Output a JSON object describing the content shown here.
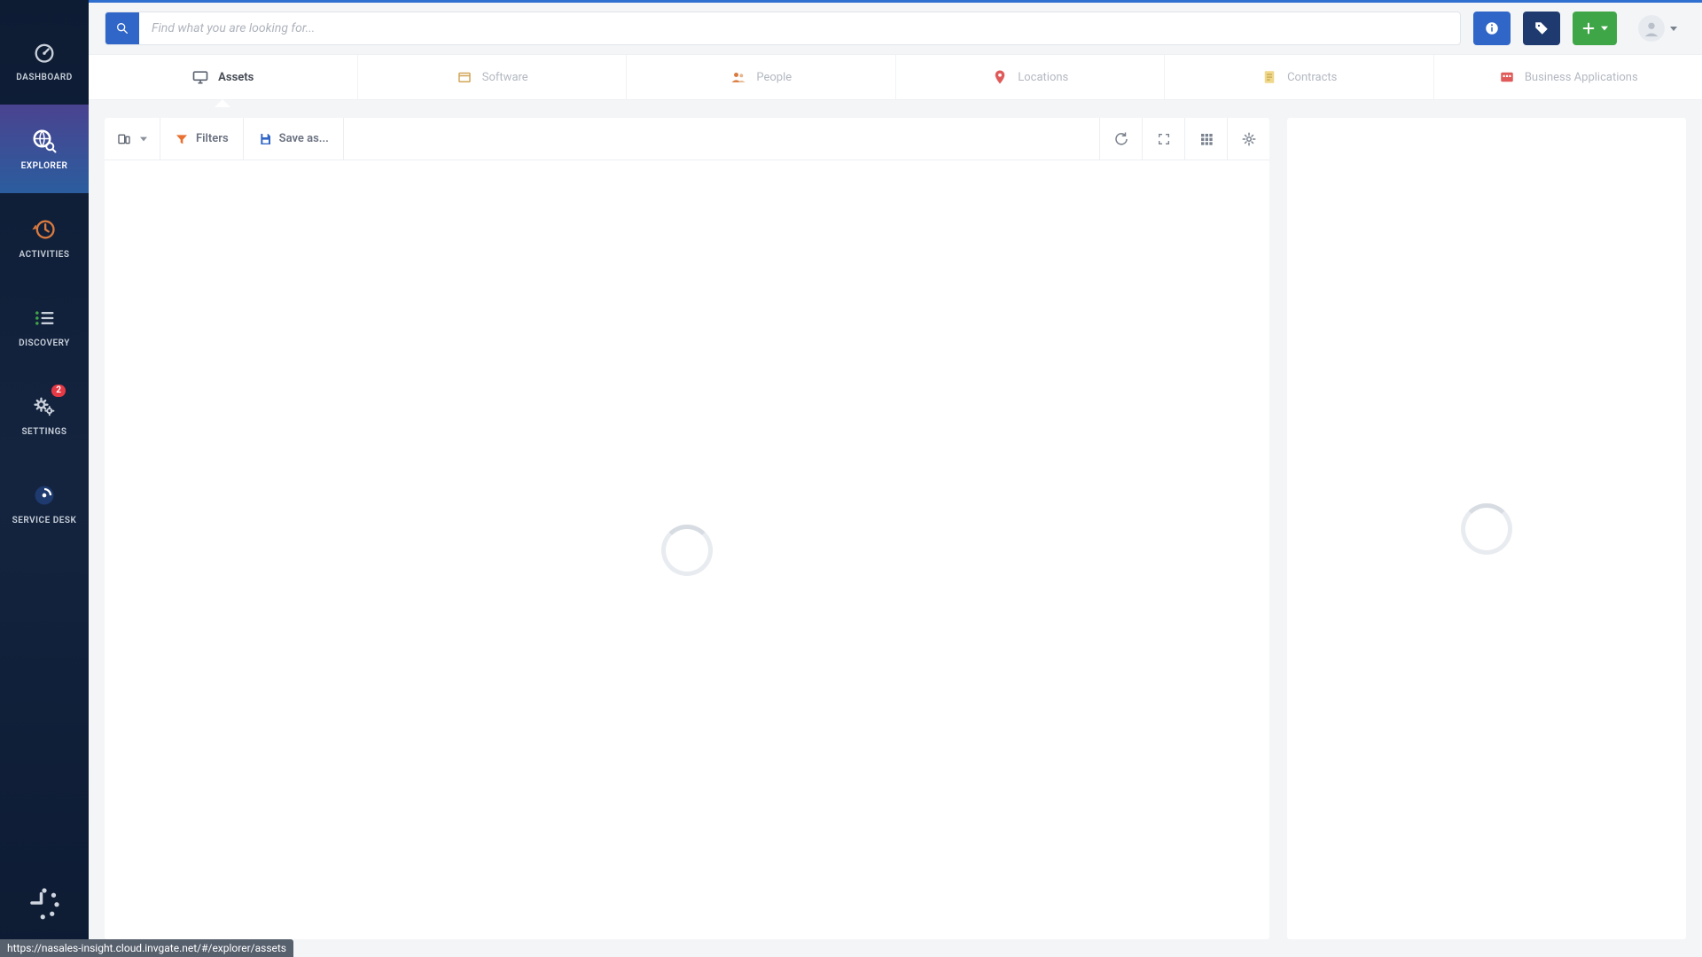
{
  "search": {
    "placeholder": "Find what you are looking for..."
  },
  "sidebar": {
    "items": [
      {
        "label": "DASHBOARD"
      },
      {
        "label": "EXPLORER"
      },
      {
        "label": "ACTIVITIES"
      },
      {
        "label": "DISCOVERY"
      },
      {
        "label": "SETTINGS",
        "badge": "2"
      },
      {
        "label": "SERVICE DESK"
      }
    ]
  },
  "tabs": [
    {
      "label": "Assets"
    },
    {
      "label": "Software"
    },
    {
      "label": "People"
    },
    {
      "label": "Locations"
    },
    {
      "label": "Contracts"
    },
    {
      "label": "Business Applications"
    }
  ],
  "toolbar": {
    "filters_label": "Filters",
    "save_as_label": "Save as..."
  },
  "status_hint": "https://nasales-insight.cloud.invgate.net/#/explorer/assets"
}
